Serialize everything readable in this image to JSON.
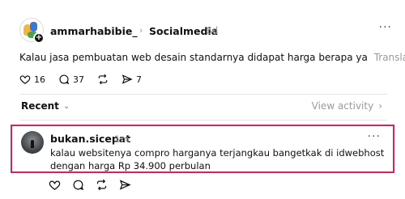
{
  "post": {
    "author": "ammarhabibie_",
    "community": "Socialmedia",
    "time_ago": "6d",
    "more_label": "···",
    "text": "Kalau jasa pembuatan web desain standarnya didapat harga berapa ya",
    "translate_label": "Translate",
    "likes": "16",
    "comments": "37",
    "shares": "7"
  },
  "filter": {
    "label": "Recent",
    "view_activity_label": "View activity"
  },
  "reply": {
    "author": "bukan.sicepat",
    "time_ago": "1m",
    "more_label": "···",
    "text": "kalau websitenya compro harganya terjangkau bangetkak di idwebhost dengan harga Rp 34.900 perbulan"
  },
  "colors": {
    "highlight_border": "#d6245a",
    "muted_text": "#999999",
    "primary_text": "#101010"
  }
}
